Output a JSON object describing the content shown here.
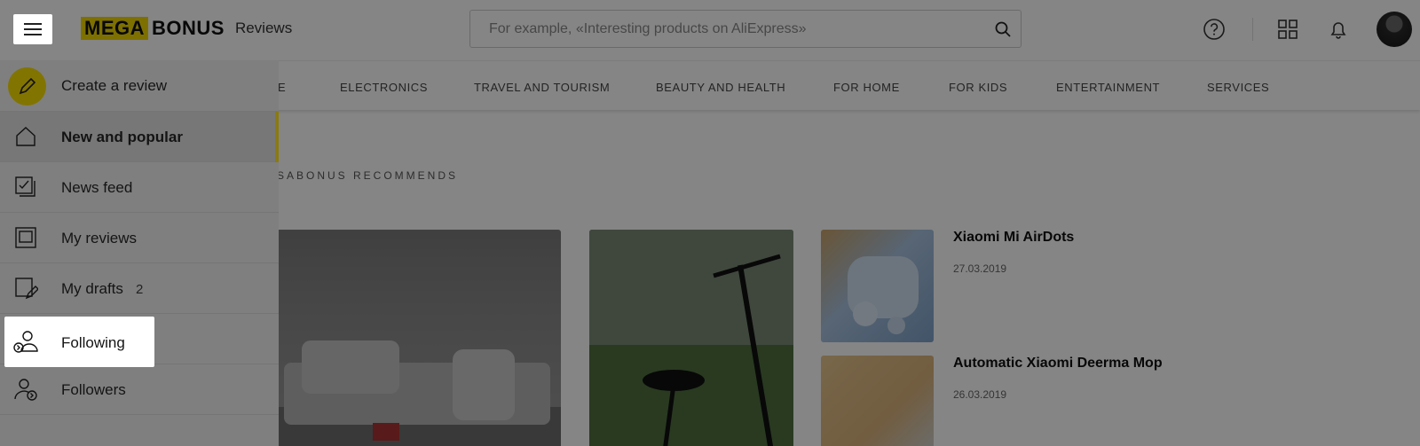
{
  "header": {
    "logo_mega": "MEGA",
    "logo_bonus": "BONUS",
    "logo_sub": "Reviews",
    "search_placeholder": "For example, «Interesting products on AliExpress»"
  },
  "categories": [
    "E",
    "ELECTRONICS",
    "TRAVEL AND TOURISM",
    "BEAUTY AND HEALTH",
    "FOR HOME",
    "FOR KIDS",
    "ENTERTAINMENT",
    "SERVICES"
  ],
  "section_title": "SABONUS RECOMMENDS",
  "items": [
    {
      "title": "Xiaomi Mi AirDots",
      "date": "27.03.2019"
    },
    {
      "title": "Automatic Xiaomi Deerma Mop",
      "date": "26.03.2019"
    }
  ],
  "sidebar": {
    "create": "Create a review",
    "items": [
      {
        "label": "New and popular",
        "count": ""
      },
      {
        "label": "News feed",
        "count": ""
      },
      {
        "label": "My reviews",
        "count": ""
      },
      {
        "label": "My drafts",
        "count": "2"
      },
      {
        "label": "Following",
        "count": ""
      },
      {
        "label": "Followers",
        "count": ""
      }
    ]
  }
}
